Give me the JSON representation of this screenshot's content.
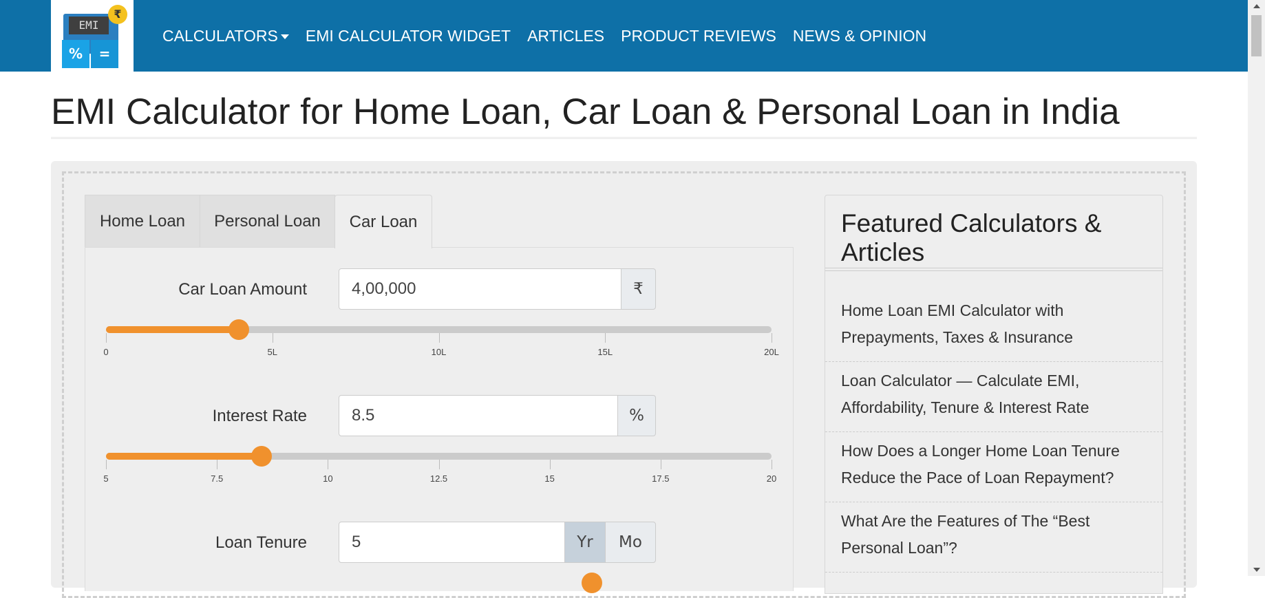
{
  "logo": {
    "screen_text": "EMI",
    "coin_symbol": "₹",
    "key_left": "%",
    "key_right": "="
  },
  "nav": {
    "items": [
      {
        "label": "CALCULATORS",
        "has_caret": true
      },
      {
        "label": "EMI CALCULATOR WIDGET"
      },
      {
        "label": "ARTICLES"
      },
      {
        "label": "PRODUCT REVIEWS"
      },
      {
        "label": "NEWS & OPINION"
      }
    ]
  },
  "page": {
    "title": "EMI Calculator for Home Loan, Car Loan & Personal Loan in India"
  },
  "tabs": [
    {
      "label": "Home Loan",
      "active": false
    },
    {
      "label": "Personal Loan",
      "active": false
    },
    {
      "label": "Car Loan",
      "active": true
    }
  ],
  "form": {
    "amount": {
      "label": "Car Loan Amount",
      "value": "4,00,000",
      "addon": "₹",
      "slider": {
        "min": 0,
        "max": 2000000,
        "value": 400000,
        "ticks": [
          "0",
          "5L",
          "10L",
          "15L",
          "20L"
        ]
      }
    },
    "interest": {
      "label": "Interest Rate",
      "value": "8.5",
      "addon": "%",
      "slider": {
        "min": 5,
        "max": 20,
        "value": 8.5,
        "ticks": [
          "5",
          "7.5",
          "10",
          "12.5",
          "15",
          "17.5",
          "20"
        ]
      }
    },
    "tenure": {
      "label": "Loan Tenure",
      "value": "5",
      "unit_year": "Yr",
      "unit_month": "Mo",
      "selected_unit": "Yr"
    }
  },
  "sidebar": {
    "title": "Featured Calculators & Articles",
    "items": [
      "Home Loan EMI Calculator with Prepayments, Taxes & Insurance",
      "Loan Calculator — Calculate EMI, Affordability, Tenure & Interest Rate",
      "How Does a Longer Home Loan Tenure Reduce the Pace of Loan Repayment?",
      "What Are the Features of The “Best Personal Loan”?"
    ]
  },
  "colors": {
    "navbar": "#0e70a7",
    "accent": "#f0912d",
    "panel": "#eeeeee"
  }
}
